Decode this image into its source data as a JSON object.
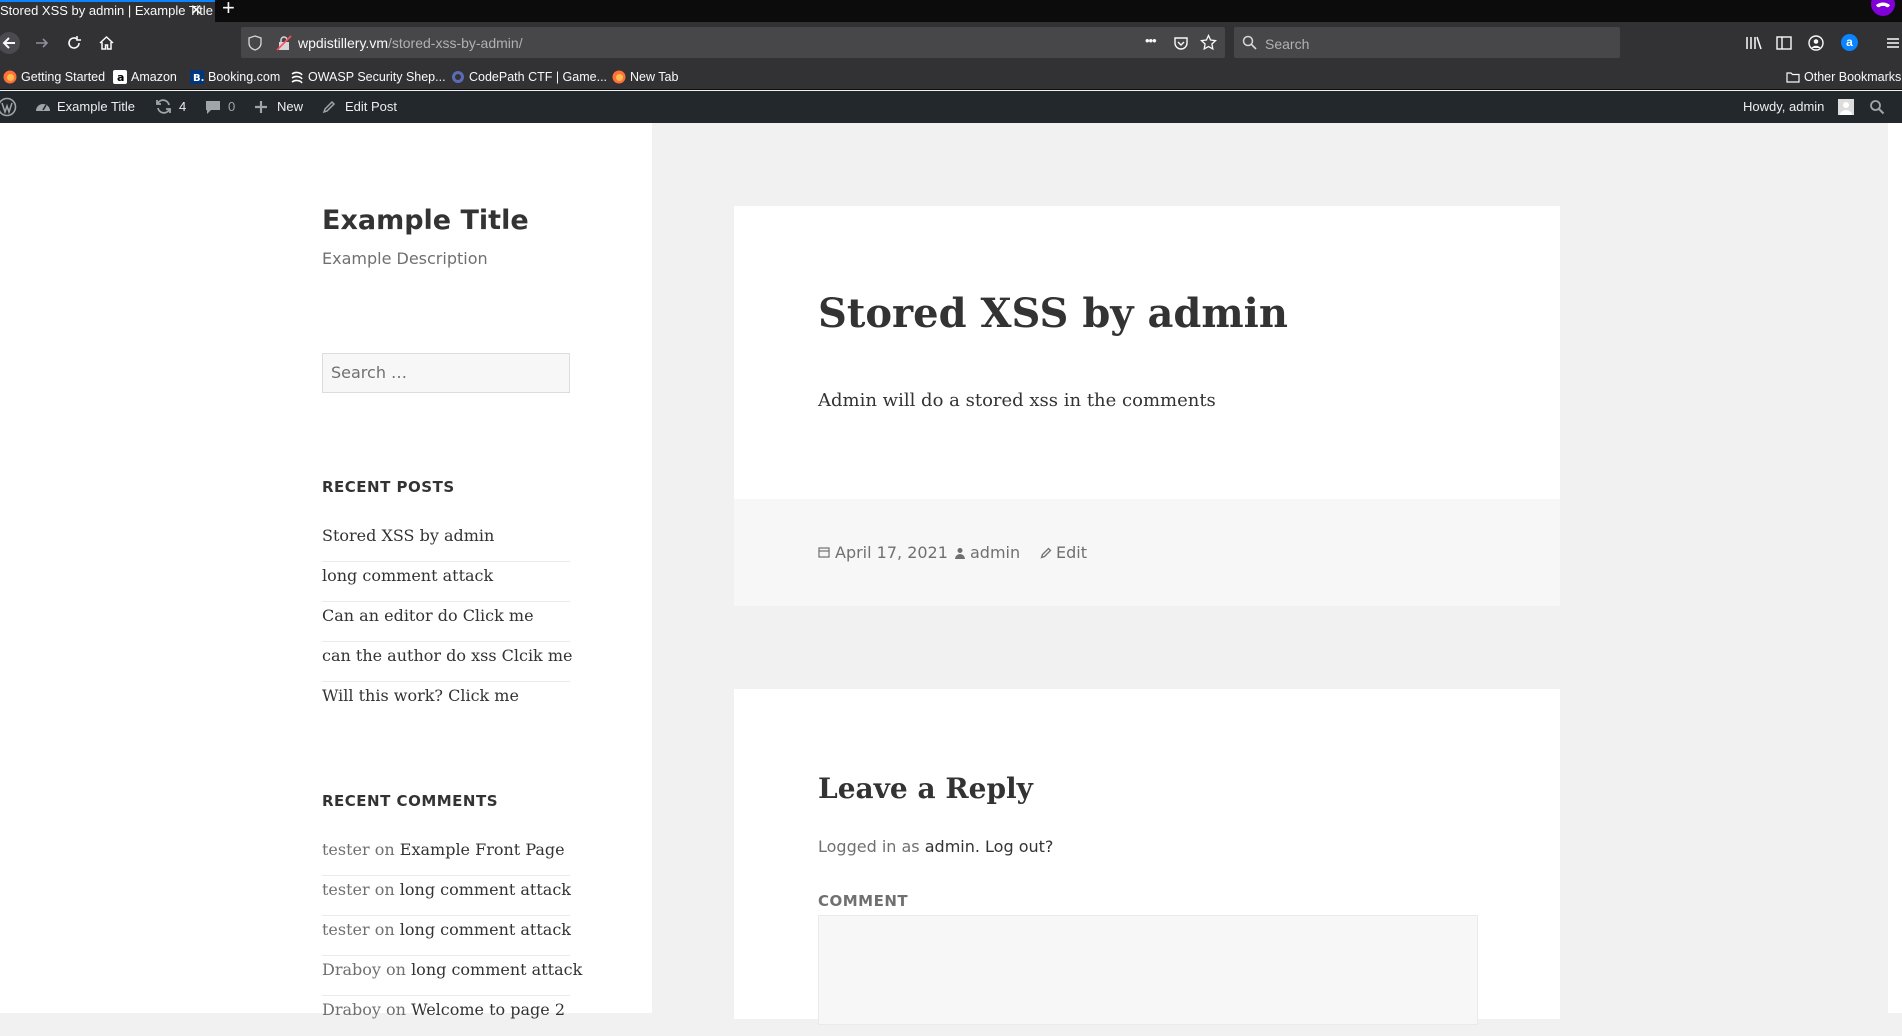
{
  "browser": {
    "tab_title": "Stored XSS by admin | Example Title",
    "tab_close": "✕",
    "new_tab": "+",
    "url_host": "wpdistillery.vm",
    "url_path": "/stored-xss-by-admin/",
    "page_actions": "•••",
    "search_placeholder": "Search",
    "accent": "#0a84ff",
    "private_color": "#8000d7"
  },
  "bookmarks": {
    "items": [
      {
        "label": "Getting Started",
        "icon": "firefox-icon"
      },
      {
        "label": "Amazon",
        "icon": "amazon-icon"
      },
      {
        "label": "Booking.com",
        "icon": "booking-icon"
      },
      {
        "label": "OWASP Security Shep...",
        "icon": "owasp-icon"
      },
      {
        "label": "CodePath CTF | Game...",
        "icon": "codepath-icon"
      },
      {
        "label": "New Tab",
        "icon": "firefox-icon"
      }
    ],
    "other": "Other Bookmarks"
  },
  "adminbar": {
    "site_name": "Example Title",
    "updates_count": "4",
    "comments_count": "0",
    "new_label": "New",
    "edit_label": "Edit Post",
    "howdy": "Howdy, admin"
  },
  "site": {
    "title": "Example Title",
    "description": "Example Description",
    "search_placeholder": "Search …"
  },
  "widgets": {
    "recent_posts_title": "RECENT POSTS",
    "recent_posts": [
      "Stored XSS by admin",
      "long comment attack",
      "Can an editor do Click me",
      "can the author do xss Clcik me",
      "Will this work? Click me"
    ],
    "recent_comments_title": "RECENT COMMENTS",
    "recent_comments": [
      {
        "author": "tester",
        "on": "on",
        "post": "Example Front Page"
      },
      {
        "author": "tester",
        "on": "on",
        "post": "long comment attack"
      },
      {
        "author": "tester",
        "on": "on",
        "post": "long comment attack"
      },
      {
        "author": "Draboy",
        "on": "on",
        "post": "long comment attack"
      },
      {
        "author": "Draboy",
        "on": "on",
        "post": "Welcome to page 2"
      }
    ]
  },
  "post": {
    "title": "Stored XSS by admin",
    "body": "Admin will do a stored xss in the comments",
    "date": "April 17, 2021",
    "author": "admin",
    "edit": "Edit"
  },
  "comments": {
    "reply_title": "Leave a Reply",
    "logged_in_prefix": "Logged in as",
    "logged_in_user": "admin.",
    "logout": "Log out?",
    "comment_label": "COMMENT"
  }
}
